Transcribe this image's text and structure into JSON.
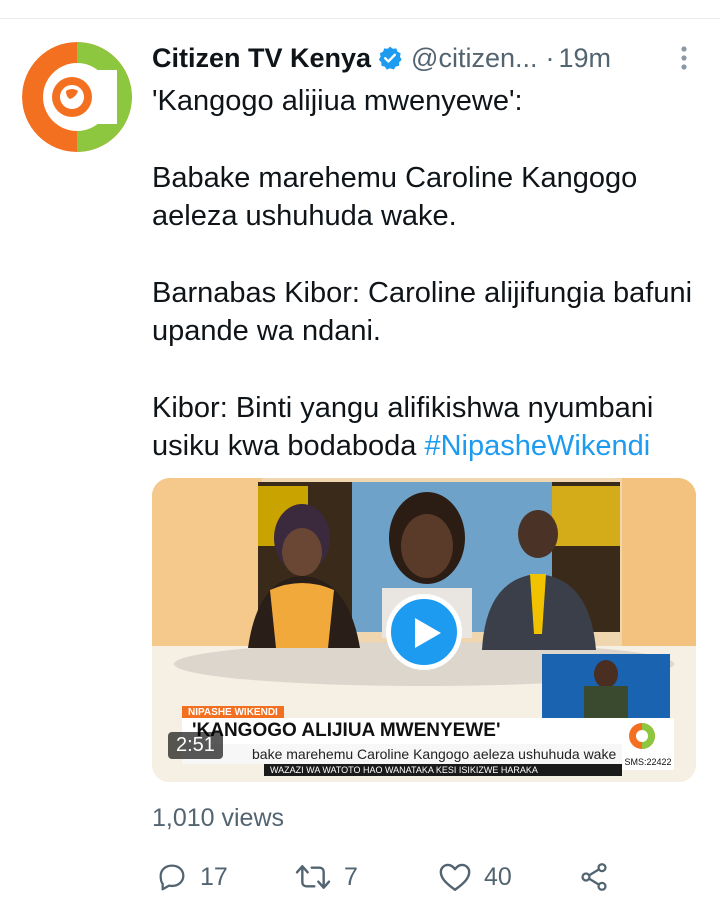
{
  "tweet": {
    "display_name": "Citizen TV Kenya",
    "handle": "@citizen...",
    "separator": "·",
    "time": "19m",
    "text_lines": [
      "'Kangogo alijiua mwenyewe':",
      "Babake marehemu Caroline Kangogo aeleza ushuhuda wake.",
      "Barnabas Kibor: Caroline alijifungia bafuni upande wa ndani.",
      "Kibor: Binti yangu alifikishwa nyumbani usiku kwa bodaboda"
    ],
    "hashtag": "#NipasheWikendi",
    "views": "1,010 views"
  },
  "media": {
    "duration": "2:51",
    "ticker_tag": "NIPASHE WIKENDI",
    "ticker_headline": "'KANGOGO ALIJIUA MWENYEWE'",
    "ticker_sub": "bake marehemu Caroline Kangogo aeleza ushuhuda wake",
    "ticker_scroll": "WAZAZI WA WATOTO HAO WANATAKA KESI ISIKIZWE HARAKA",
    "sms": "SMS:22422"
  },
  "actions": {
    "replies": "17",
    "retweets": "7",
    "likes": "40"
  },
  "colors": {
    "accent": "#1d9bf0",
    "brand_orange": "#f37021",
    "brand_green": "#8dc63f",
    "muted": "#536471"
  }
}
